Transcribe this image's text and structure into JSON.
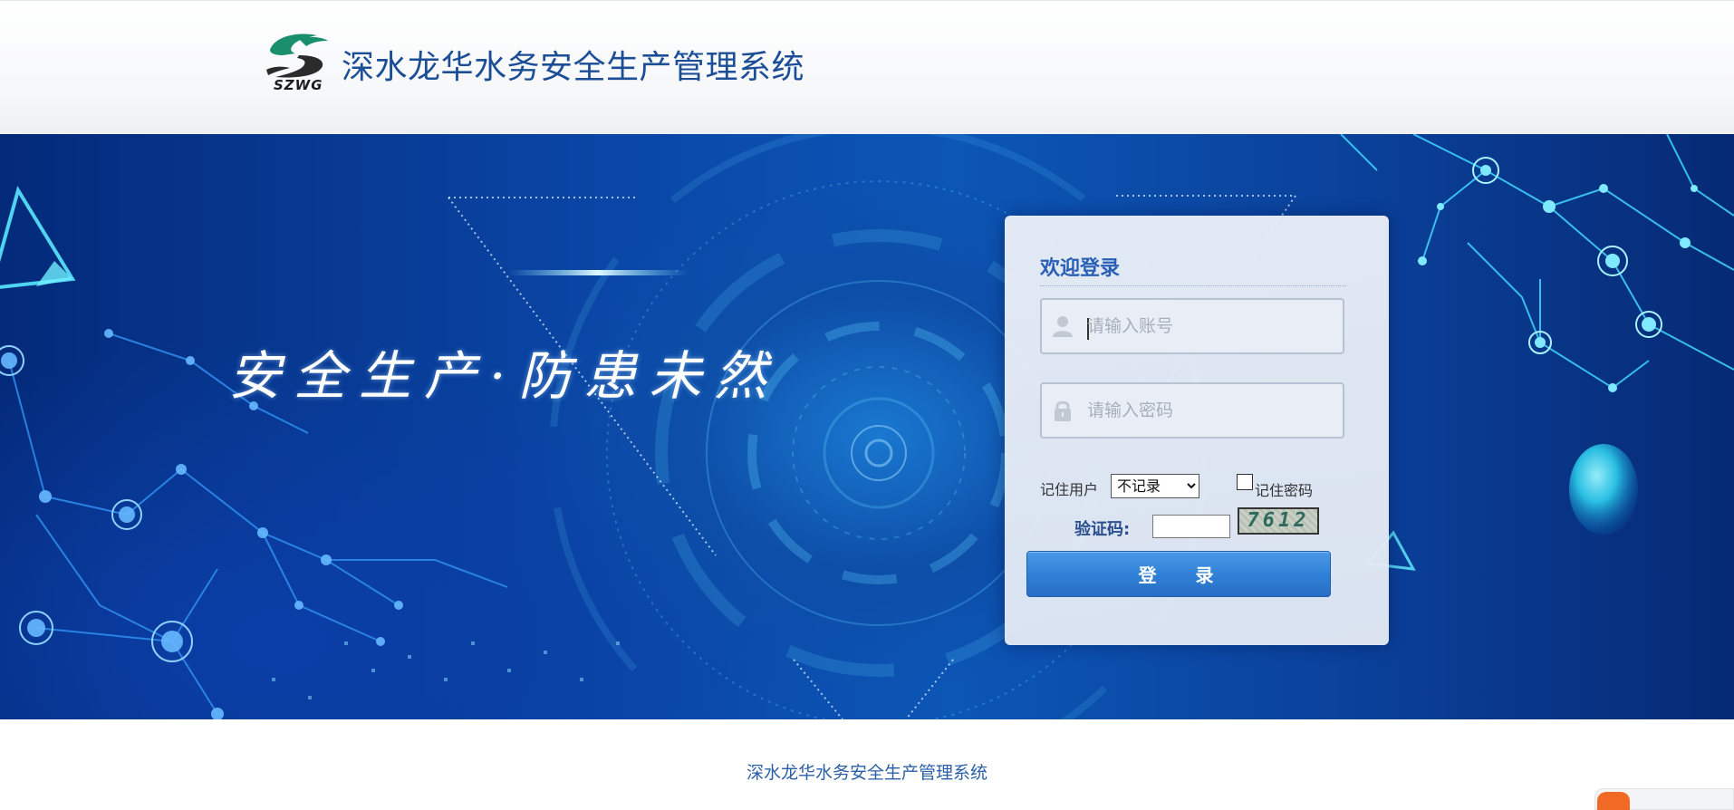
{
  "header": {
    "logo_text": "SZWG",
    "title": "深水龙华水务安全生产管理系统"
  },
  "banner": {
    "slogan": "安全生产·防患未然"
  },
  "login": {
    "welcome": "欢迎登录",
    "username": {
      "placeholder": "请输入账号",
      "value": "",
      "icon": "user-icon"
    },
    "password": {
      "placeholder": "请输入密码",
      "value": "",
      "icon": "lock-icon"
    },
    "remember_user_label": "记住用户",
    "remember_user_selected": "不记录",
    "remember_password_label": "记住密码",
    "remember_password_checked": false,
    "captcha_label": "验证码:",
    "captcha_value": "",
    "captcha_code": "7612",
    "login_button": "登 录"
  },
  "footer": {
    "text": "深水龙华水务安全生产管理系统"
  },
  "colors": {
    "title_blue": "#1b4e97",
    "button_blue": "#2f7fd6",
    "logo_green": "#1a8f6e",
    "logo_dark": "#2b2b2b",
    "banner_blue": "#0a46a6",
    "corner_widget_orange": "#f06a25"
  }
}
